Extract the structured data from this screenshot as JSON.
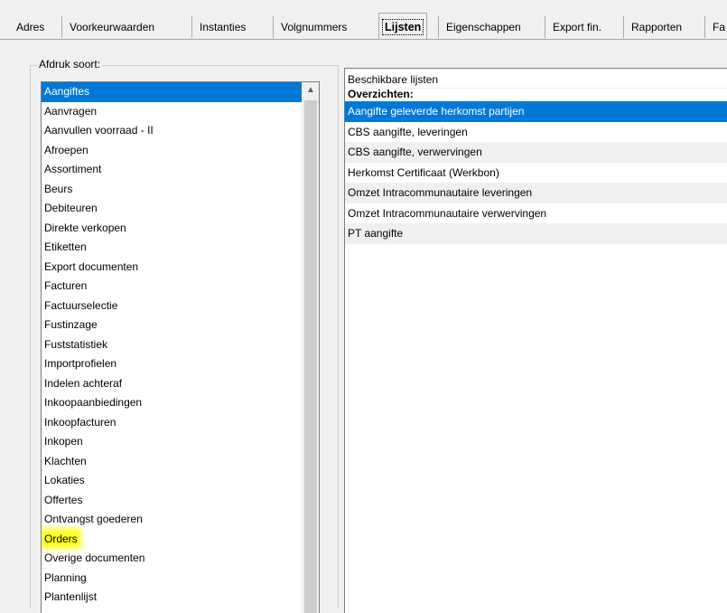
{
  "tabs": [
    {
      "label": "Adres",
      "active": false
    },
    {
      "label": "Voorkeurwaarden",
      "active": false
    },
    {
      "label": "Instanties",
      "active": false
    },
    {
      "label": "Volgnummers",
      "active": false
    },
    {
      "label": "Lijsten",
      "active": true
    },
    {
      "label": "Eigenschappen",
      "active": false
    },
    {
      "label": "Export fin.",
      "active": false
    },
    {
      "label": "Rapporten",
      "active": false
    },
    {
      "label": "Fa",
      "active": false
    }
  ],
  "group": {
    "label": "Afdruk soort:"
  },
  "print_types": [
    "Aangiftes",
    "Aanvragen",
    "Aanvullen voorraad - II",
    "Afroepen",
    "Assortiment",
    "Beurs",
    "Debiteuren",
    "Direkte verkopen",
    "Etiketten",
    "Export documenten",
    "Facturen",
    "Factuurselectie",
    "Fustinzage",
    "Fuststatistiek",
    "Importprofielen",
    "Indelen achteraf",
    "Inkoopaanbiedingen",
    "Inkoopfacturen",
    "Inkopen",
    "Klachten",
    "Lokaties",
    "Offertes",
    "Ontvangst goederen",
    "Orders",
    "Overige documenten",
    "Planning",
    "Plantenlijst"
  ],
  "print_types_selected_index": 0,
  "print_types_highlight_index": 23,
  "lists": {
    "header": "Beschikbare lijsten",
    "group_label": "Overzichten:",
    "items": [
      "Aangifte geleverde herkomst partijen",
      "CBS aangifte, leveringen",
      "CBS aangifte, verwervingen",
      "Herkomst Certificaat (Werkbon)",
      "Omzet Intracommunautaire leveringen",
      "Omzet Intracommunautaire verwervingen",
      "PT aangifte"
    ],
    "selected_index": 0
  },
  "colors": {
    "selection": "#0078d7",
    "highlighter": "#ffff1e"
  }
}
